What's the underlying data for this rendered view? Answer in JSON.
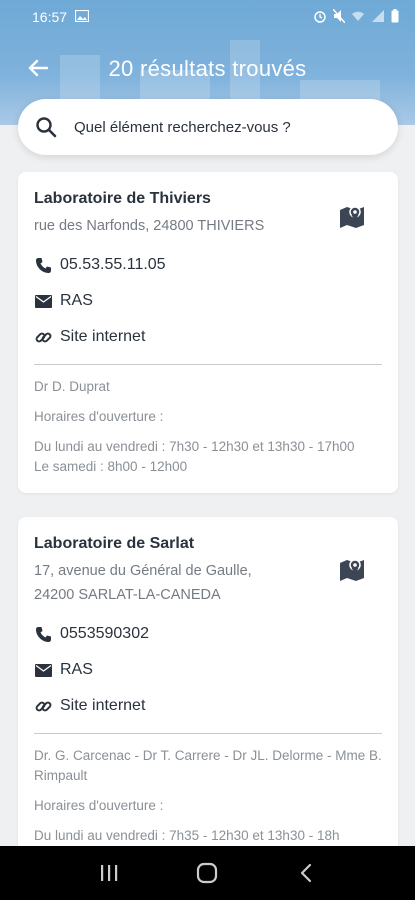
{
  "status_bar": {
    "time": "16:57"
  },
  "header": {
    "title": "20 résultats trouvés"
  },
  "search": {
    "placeholder": "Quel élément recherchez-vous ?"
  },
  "colors": {
    "header": "#7fb2dc",
    "text": "#2a323d",
    "muted": "#8a9096"
  },
  "results": [
    {
      "name": "Laboratoire de Thiviers",
      "address_line1": "rue des Narfonds, 24800 THIVIERS",
      "address_line2": "",
      "phone": "05.53.55.11.05",
      "email": "RAS",
      "website_label": "Site internet",
      "doctors": "Dr D. Duprat",
      "hours_label": "Horaires d'ouverture :",
      "hours_weekdays": "Du lundi au vendredi : 7h30 - 12h30 et 13h30 - 17h00",
      "hours_saturday": "Le samedi : 8h00 - 12h00"
    },
    {
      "name": "Laboratoire de Sarlat",
      "address_line1": "17, avenue du Général de Gaulle,",
      "address_line2": "24200 SARLAT-LA-CANEDA",
      "phone": "0553590302",
      "email": "RAS",
      "website_label": "Site internet",
      "doctors": "Dr. G. Carcenac - Dr T. Carrere - Dr JL. Delorme - Mme B. Rimpault",
      "hours_label": "Horaires d'ouverture :",
      "hours_weekdays": "Du lundi au vendredi : 7h35 - 12h30 et 13h30 - 18h",
      "hours_saturday": ""
    }
  ],
  "icons": {
    "back": "arrow-left-icon",
    "search": "search-icon",
    "map": "map-icon",
    "phone": "phone-icon",
    "email": "envelope-icon",
    "link": "link-icon"
  }
}
